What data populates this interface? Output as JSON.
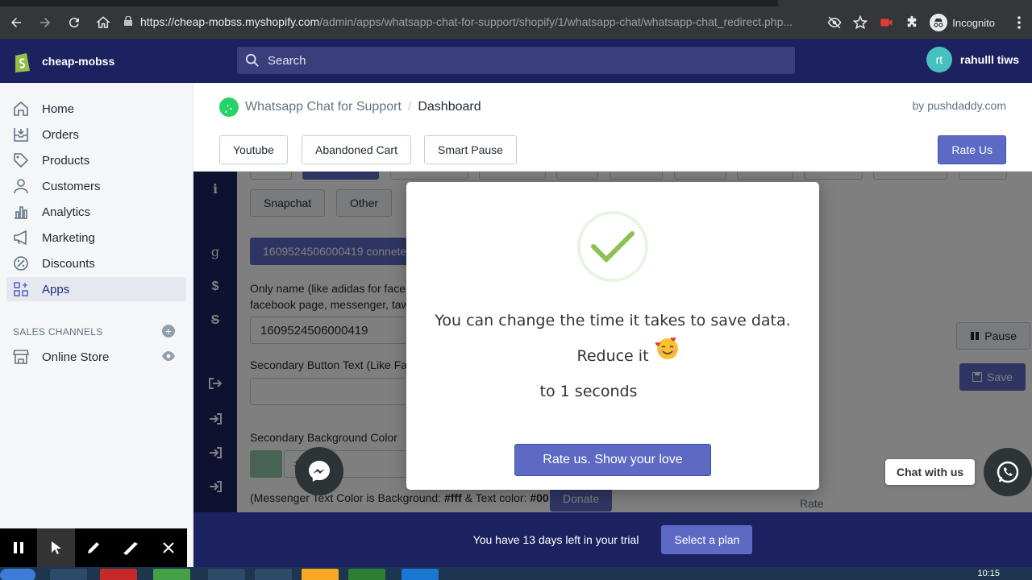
{
  "browser": {
    "url_host": "https://cheap-mobss.myshopify.com",
    "url_path": "/admin/apps/whatsapp-chat-for-support/shopify/1/whatsapp-chat/whatsapp-chat_redirect.php...",
    "profile_label": "Incognito"
  },
  "topbar": {
    "store_name": "cheap-mobss",
    "search_placeholder": "Search",
    "user_initials": "rt",
    "user_name": "rahulll tiws"
  },
  "sidebar": {
    "items": [
      {
        "label": "Home",
        "icon": "home-icon"
      },
      {
        "label": "Orders",
        "icon": "orders-icon"
      },
      {
        "label": "Products",
        "icon": "tag-icon"
      },
      {
        "label": "Customers",
        "icon": "person-icon"
      },
      {
        "label": "Analytics",
        "icon": "bar-chart-icon"
      },
      {
        "label": "Marketing",
        "icon": "megaphone-icon"
      },
      {
        "label": "Discounts",
        "icon": "discount-icon"
      },
      {
        "label": "Apps",
        "icon": "apps-icon"
      }
    ],
    "active": "Apps",
    "sales_channels_title": "SALES CHANNELS",
    "online_store": "Online Store"
  },
  "app_header": {
    "app_name": "Whatsapp Chat for Support",
    "separator": "/",
    "page": "Dashboard",
    "by": "by pushdaddy.com",
    "buttons": [
      "Youtube",
      "Abandoned Cart",
      "Smart Pause"
    ],
    "rate_us": "Rate Us"
  },
  "content": {
    "tags": [
      "Snapchat",
      "Other"
    ],
    "connected_text": "1609524506000419 connete",
    "only_name_label_1": "Only name (like adidas for facel",
    "only_name_label_2": "facebook page, messenger, taw",
    "id_value": "1609524506000419",
    "secondary_button_label": "Secondary Button Text (Like Fac",
    "secondary_bg_label": "Secondary Background Color",
    "hex_prefix": "#",
    "messenger_note_prefix": "(Messenger Text Color is Background: ",
    "messenger_note_fff": "#fff",
    "messenger_note_mid": " & Text color: ",
    "messenger_note_00": "#00",
    "donate": "Donate",
    "pause": "Pause",
    "save": "Save",
    "rate": "Rate",
    "swatch_color": "#8fc7a8"
  },
  "modal": {
    "line1": "You can change the time it takes to save data. Reduce it",
    "line2": "to 1 seconds",
    "cta": "Rate us. Show your love"
  },
  "widgets": {
    "chat_with_us": "Chat with us"
  },
  "trial": {
    "text": "You have 13 days left in your trial",
    "button": "Select a plan"
  },
  "taskbar": {
    "clock": "10:15"
  },
  "colors": {
    "shopify_navy": "#1c2260",
    "indigo": "#5c6ac4",
    "whatsapp_green": "#25d366",
    "check_green": "#8cc152"
  }
}
